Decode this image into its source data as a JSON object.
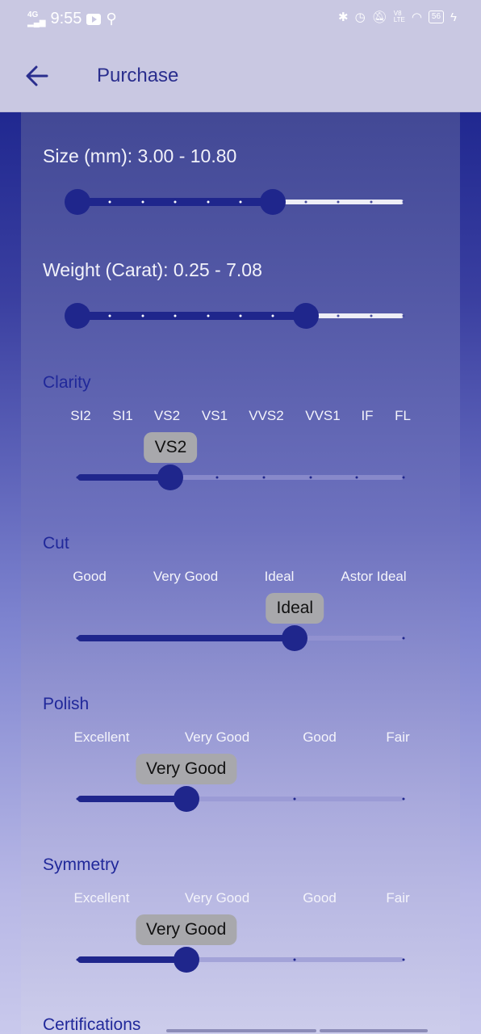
{
  "status_bar": {
    "network": "4G",
    "time": "9:55",
    "battery": "56"
  },
  "app_bar": {
    "title": "Purchase",
    "back_icon": "arrow-left-icon"
  },
  "filters": {
    "size": {
      "label": "Size (mm): 3.00 - 10.80",
      "min": 3.0,
      "max": 10.8,
      "selected_fraction_start": 0,
      "selected_fraction_end": 0.6
    },
    "weight": {
      "label": "Weight (Carat): 0.25 - 7.08",
      "min": 0.25,
      "max": 7.08,
      "selected_fraction_start": 0,
      "selected_fraction_end": 0.7
    },
    "clarity": {
      "title": "Clarity",
      "options": [
        "SI2",
        "SI1",
        "VS2",
        "VS1",
        "VVS2",
        "VVS1",
        "IF",
        "FL"
      ],
      "selected": "VS2",
      "selected_index": 2
    },
    "cut": {
      "title": "Cut",
      "options": [
        "Good",
        "Very Good",
        "Ideal",
        "Astor Ideal"
      ],
      "selected": "Ideal",
      "selected_index": 2
    },
    "polish": {
      "title": "Polish",
      "options": [
        "Excellent",
        "Very Good",
        "Good",
        "Fair"
      ],
      "selected": "Very Good",
      "selected_index": 1
    },
    "symmetry": {
      "title": "Symmetry",
      "options": [
        "Excellent",
        "Very Good",
        "Good",
        "Fair"
      ],
      "selected": "Very Good",
      "selected_index": 1
    },
    "certifications": {
      "title": "Certifications"
    }
  },
  "colors": {
    "accent": "#1f268c",
    "title": "#20289a",
    "bubble": "#a8a8ac"
  }
}
